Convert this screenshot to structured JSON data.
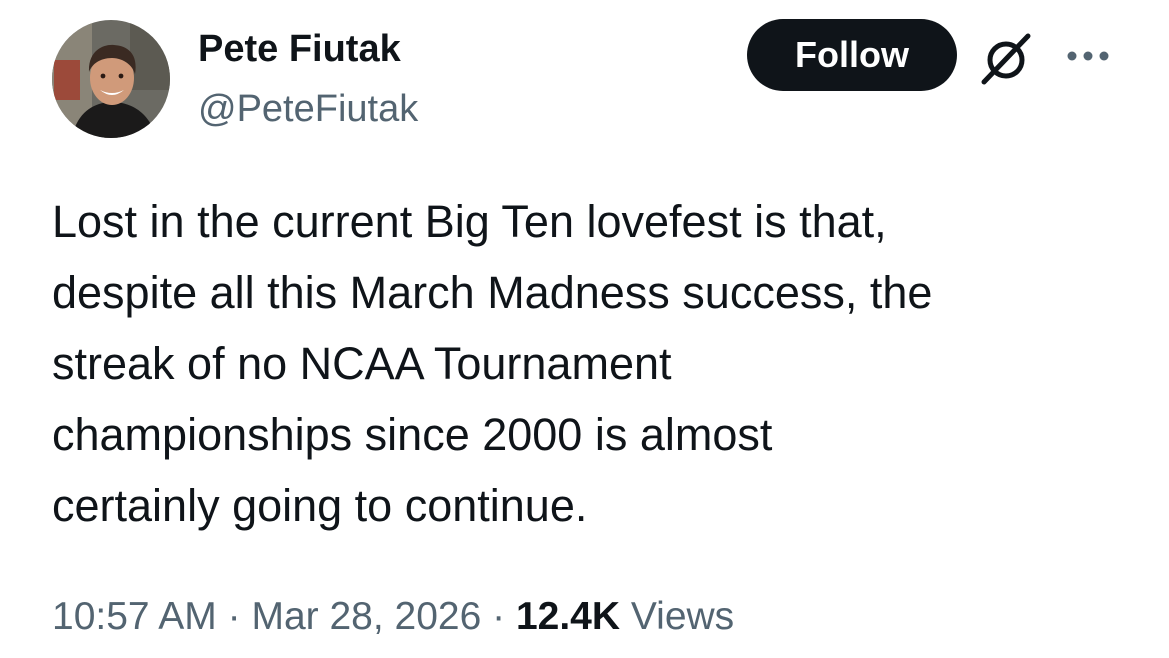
{
  "author": {
    "display_name": "Pete Fiutak",
    "handle": "@PeteFiutak",
    "avatar_icon": "profile-photo"
  },
  "actions": {
    "follow_label": "Follow",
    "grok_icon": "grok-icon",
    "more_icon": "more-options-icon"
  },
  "tweet": {
    "lines": [
      "Lost in the current Big Ten lovefest is that,",
      "despite all this March Madness success, the",
      "streak of no NCAA Tournament",
      "championships since 2000 is almost",
      "certainly going to continue."
    ]
  },
  "meta": {
    "time": "10:57 AM",
    "separator": " · ",
    "date": "Mar 28, 2026",
    "views_count": "12.4K",
    "views_label": "Views"
  },
  "colors": {
    "text_primary": "#0f1419",
    "text_secondary": "#536471",
    "follow_bg": "#0f1419",
    "follow_text": "#ffffff"
  }
}
